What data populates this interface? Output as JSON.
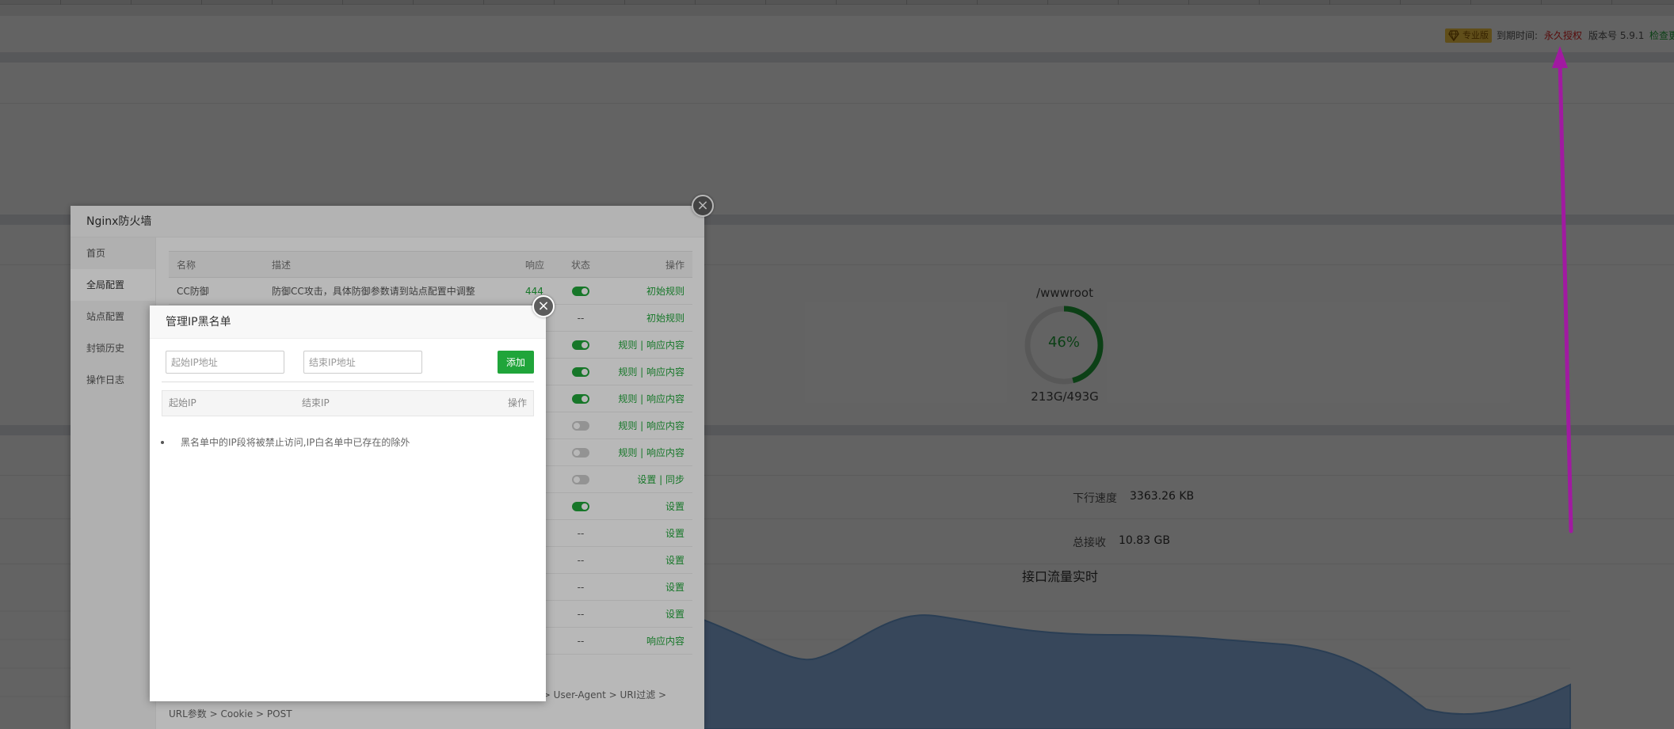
{
  "header": {
    "pro_label": "专业版",
    "expire_label": "到期时间:",
    "expire_value": "永久授权",
    "version": "版本号 5.9.1",
    "check_update": "检查更新"
  },
  "disk": {
    "path": "/wwwroot",
    "percent_text": "46%",
    "percent": 46,
    "size": "213G/493G"
  },
  "network": {
    "down_speed_label": "下行速度",
    "down_speed_value": "3363.26 KB",
    "total_recv_label": "总接收",
    "total_recv_value": "10.83 GB",
    "chart_title": "接口流量实时"
  },
  "firewall": {
    "title": "Nginx防火墙",
    "nav": [
      "首页",
      "全局配置",
      "站点配置",
      "封锁历史",
      "操作日志"
    ],
    "columns": {
      "name": "名称",
      "desc": "描述",
      "resp": "响应",
      "status": "状态",
      "op": "操作"
    },
    "rows": [
      {
        "name": "CC防御",
        "desc": "防御CC攻击，具体防御参数请到站点配置中调整",
        "resp": "444",
        "status": "on",
        "op": "初始规则"
      },
      {
        "name": "",
        "desc": "",
        "resp": "",
        "status": "--",
        "op": "初始规则"
      },
      {
        "name": "",
        "desc": "",
        "resp": "",
        "status": "on",
        "op": "规则 | 响应内容"
      },
      {
        "name": "",
        "desc": "",
        "resp": "",
        "status": "on",
        "op": "规则 | 响应内容"
      },
      {
        "name": "",
        "desc": "",
        "resp": "",
        "status": "on",
        "op": "规则 | 响应内容"
      },
      {
        "name": "",
        "desc": "",
        "resp": "",
        "status": "off",
        "op": "规则 | 响应内容"
      },
      {
        "name": "",
        "desc": "",
        "resp": "",
        "status": "off",
        "op": "规则 | 响应内容"
      },
      {
        "name": "",
        "desc": "",
        "resp": "",
        "status": "off",
        "op": "设置 | 同步"
      },
      {
        "name": "",
        "desc": "",
        "resp": "",
        "status": "on",
        "op": "设置"
      },
      {
        "name": "",
        "desc": "",
        "resp": "",
        "status": "--",
        "op": "设置"
      },
      {
        "name": "",
        "desc": "",
        "resp": "",
        "status": "--",
        "op": "设置"
      },
      {
        "name": "",
        "desc": "",
        "resp": "",
        "status": "--",
        "op": "设置"
      },
      {
        "name": "",
        "desc": "",
        "resp": "",
        "status": "--",
        "op": "设置"
      },
      {
        "name": "",
        "desc": "",
        "resp": "",
        "status": "--",
        "op": "响应内容"
      }
    ],
    "note_line1": "问 > User-Agent > URI过滤 >",
    "note_line2": "URL参数 > Cookie > POST"
  },
  "blacklist": {
    "title": "管理IP黑名单",
    "start_placeholder": "起始IP地址",
    "end_placeholder": "结束IP地址",
    "add_label": "添加",
    "col_start": "起始IP",
    "col_end": "结束IP",
    "col_op": "操作",
    "tip": "黑名单中的IP段将被禁止访问,IP白名单中已存在的除外"
  },
  "colors": {
    "accent": "#20a53a",
    "warning": "#e02020",
    "badge": "#f7c844",
    "annotation_arrow": "#e024e0",
    "chart_fill": "#8fb8ea"
  }
}
